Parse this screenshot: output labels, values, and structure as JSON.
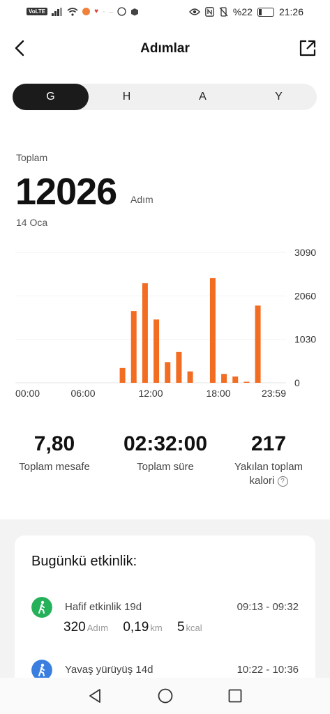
{
  "status_bar": {
    "volte": "VoLTE",
    "battery": "%22",
    "time": "21:26"
  },
  "header": {
    "title": "Adımlar",
    "back_icon": "back-arrow-icon",
    "share_icon": "share-icon"
  },
  "tabs": [
    {
      "label": "G",
      "active": true
    },
    {
      "label": "H",
      "active": false
    },
    {
      "label": "A",
      "active": false
    },
    {
      "label": "Y",
      "active": false
    }
  ],
  "summary": {
    "label": "Toplam",
    "value": "12026",
    "unit": "Adım",
    "date": "14 Oca"
  },
  "chart_data": {
    "type": "bar",
    "bar_color": "#f26d21",
    "x_tick_labels": [
      "00:00",
      "06:00",
      "12:00",
      "18:00",
      "23:59"
    ],
    "y_tick_labels": [
      "3090",
      "2060",
      "1030",
      "0"
    ],
    "ylim": [
      0,
      3090
    ],
    "x_range_hours": [
      0,
      24
    ],
    "series": [
      {
        "hours": [
          9.0,
          10.0,
          11.0,
          12.0,
          13.0,
          14.0,
          15.0,
          17.0,
          18.0,
          19.0,
          20.0,
          21.0
        ],
        "values": [
          350,
          1700,
          2360,
          1500,
          490,
          730,
          270,
          2480,
          210,
          150,
          20,
          1830
        ]
      }
    ],
    "grid": true
  },
  "stats": [
    {
      "value": "7,80",
      "label": "Toplam mesafe"
    },
    {
      "value": "02:32:00",
      "label": "Toplam süre"
    },
    {
      "value": "217",
      "label_line1": "Yakılan toplam",
      "label_line2": "kalori",
      "help_icon": "question-icon"
    }
  ],
  "activity": {
    "title": "Bugünkü etkinlik:",
    "items": [
      {
        "name": "Hafif etkinlik 19d",
        "time": "09:13 - 09:32",
        "icon_color": "#25b15a",
        "steps": "320",
        "steps_unit": "Adım",
        "distance": "0,19",
        "distance_unit": "km",
        "kcal": "5",
        "kcal_unit": "kcal"
      },
      {
        "name": "Yavaş yürüyüş 14d",
        "time": "10:22 - 10:36",
        "icon_color": "#3a7fe0"
      }
    ]
  }
}
